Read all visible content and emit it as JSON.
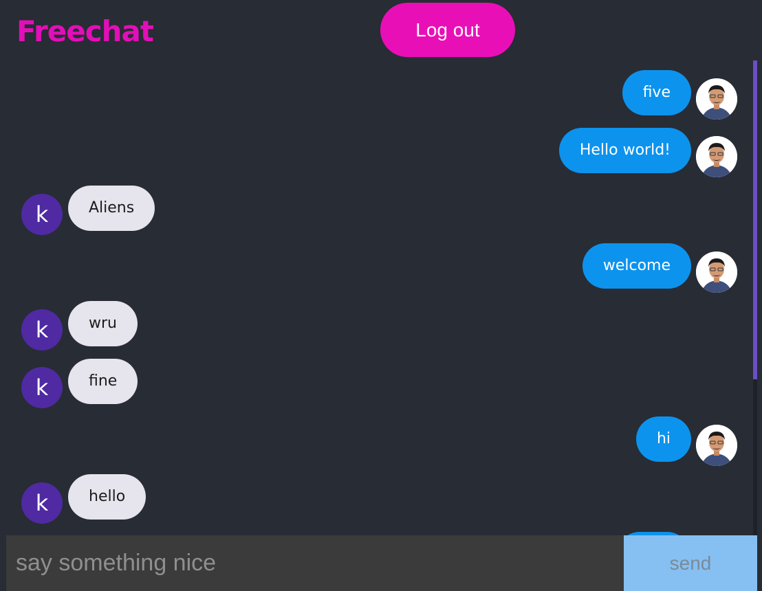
{
  "app": {
    "brand": "Freechat",
    "logout_label": "Log out"
  },
  "colors": {
    "background": "#282c34",
    "brand": "#e20fb8",
    "logout_bg": "#e90fb7",
    "sent_bubble": "#0c93ee",
    "received_bubble": "#e6e4ec",
    "avatar_letter_bg": "#4f2aa3",
    "send_button_bg": "#86c0f2",
    "send_button_text": "#7a8a99"
  },
  "messages": [
    {
      "direction": "sent",
      "text": "five",
      "avatar": "user-photo"
    },
    {
      "direction": "sent",
      "text": "Hello world!",
      "avatar": "user-photo"
    },
    {
      "direction": "received",
      "text": "Aliens",
      "avatar_letter": "k"
    },
    {
      "direction": "sent",
      "text": "welcome",
      "avatar": "user-photo"
    },
    {
      "direction": "received",
      "text": "wru",
      "avatar_letter": "k"
    },
    {
      "direction": "received",
      "text": "fine",
      "avatar_letter": "k"
    },
    {
      "direction": "sent",
      "text": "hi",
      "avatar": "user-photo"
    },
    {
      "direction": "received",
      "text": "hello",
      "avatar_letter": "k"
    }
  ],
  "composer": {
    "placeholder": "say something nice",
    "value": "",
    "send_label": "send"
  }
}
